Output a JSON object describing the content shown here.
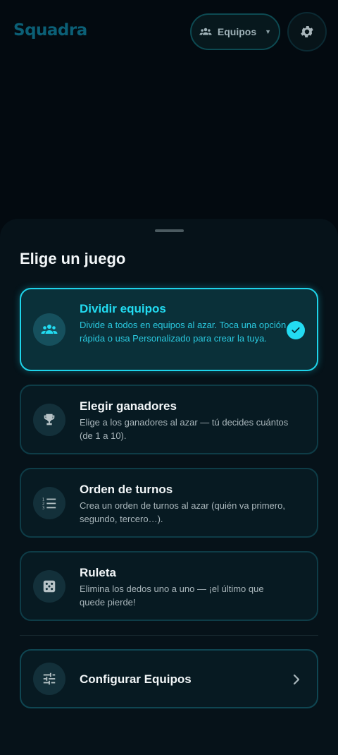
{
  "header": {
    "logo": "Squadra",
    "mode_button": {
      "label": "Equipos",
      "icon": "people-icon"
    },
    "settings_icon": "gear-icon"
  },
  "sheet": {
    "title": "Elige un juego",
    "games": [
      {
        "title": "Dividir equipos",
        "description": "Divide a todos en equipos al azar. Toca una opción rápida o usa Personalizado para crear la tuya.",
        "icon": "group-icon",
        "selected": true
      },
      {
        "title": "Elegir ganadores",
        "description": "Elige a los ganadores al azar — tú decides cuántos (de 1 a 10).",
        "icon": "trophy-icon",
        "selected": false
      },
      {
        "title": "Orden de turnos",
        "description": "Crea un orden de turnos al azar (quién va primero, segundo, tercero…).",
        "icon": "numbered-list-icon",
        "selected": false
      },
      {
        "title": "Ruleta",
        "description": "Elimina los dedos uno a uno — ¡el último que quede pierde!",
        "icon": "dice-icon",
        "selected": false
      }
    ],
    "config": {
      "label": "Configurar Equipos",
      "icon": "sliders-icon"
    }
  },
  "colors": {
    "background": "#030a10",
    "sheet": "#061219",
    "accent": "#22dcf2",
    "card_border": "#0e3c47"
  }
}
